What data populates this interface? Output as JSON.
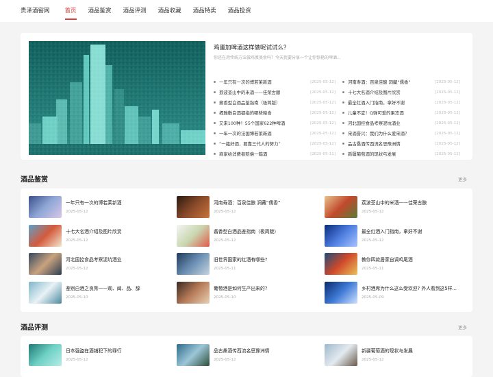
{
  "nav": {
    "items": [
      {
        "label": "贵泽酒窖网",
        "active": false
      },
      {
        "label": "首页",
        "active": true
      },
      {
        "label": "酒品鉴赏",
        "active": false
      },
      {
        "label": "酒品评测",
        "active": false
      },
      {
        "label": "酒品收藏",
        "active": false
      },
      {
        "label": "酒品特卖",
        "active": false
      },
      {
        "label": "酒品投资",
        "active": false
      }
    ]
  },
  "hero": {
    "title": "鸡蛋加啤酒这样做呢试试么？",
    "subtitle": "你还在用传统方法做鸡蛋美食吗？今天我要分享一个让你惊艳的啤酒...",
    "list_left": [
      {
        "title": "一年只有一次的博若莱新酒",
        "date": "[2025-05-12]"
      },
      {
        "title": "荔波荃山中的米酒——佳荣古酿",
        "date": "[2025-05-12]"
      },
      {
        "title": "酱香型白酒品鉴指南（极简版）",
        "date": "[2025-05-12]"
      },
      {
        "title": "揭雅敷白酒都指的哪些粮食",
        "date": "[2025-05-12]"
      },
      {
        "title": "又来100种！55个国家622种啤酒",
        "date": "[2025-05-12]"
      },
      {
        "title": "一年一次的法国博若莱新酒",
        "date": "[2025-05-12]"
      },
      {
        "title": "“一瓶好酒，要靠三代人的努力”",
        "date": "[2025-05-12]"
      },
      {
        "title": "商家给消费者赔偿一箱酒",
        "date": "[2025-05-11]"
      }
    ],
    "list_right": [
      {
        "title": "河南寿酒：百泉佳酿 洞藏“儒香”",
        "date": "[2025-05-12]"
      },
      {
        "title": "十七大名酒介绍及图片欣赏",
        "date": "[2025-05-12]"
      },
      {
        "title": "最全红酒入门指南，拿好不谢",
        "date": "[2025-05-12]"
      },
      {
        "title": "儿童不宜！Q弹可爱的果冻酒",
        "date": "[2025-05-12]"
      },
      {
        "title": "河北国控食品考察泥坑酒业",
        "date": "[2025-05-12]"
      },
      {
        "title": "宋酒誉兴：我们为什么爱宋酒？",
        "date": "[2025-05-12]"
      },
      {
        "title": "品古桑酒传西流名思豫洲情",
        "date": "[2025-05-12]"
      },
      {
        "title": "新疆葡萄酒的现状与发展",
        "date": "[2025-05-11]"
      }
    ]
  },
  "section1": {
    "title": "酒品鉴赏",
    "more": "更多",
    "items": [
      {
        "title": "一年只有一次的博若莱新酒",
        "date": "2025-05-12",
        "thumb": "grapes"
      },
      {
        "title": "河南寿酒：百泉佳酿 洞藏“儒香”",
        "date": "2025-05-12",
        "thumb": "cellar"
      },
      {
        "title": "荔波荃山中的米酒——佳荣古酿",
        "date": "2025-05-12",
        "thumb": "market"
      },
      {
        "title": "十七大名酒介绍及图片欣赏",
        "date": "2025-05-12",
        "thumb": "bottles"
      },
      {
        "title": "酱香型白酒品鉴指南（极简版）",
        "date": "2025-05-12",
        "thumb": "map"
      },
      {
        "title": "最全红酒入门指南，拿好不谢",
        "date": "2025-05-12",
        "thumb": "blue"
      },
      {
        "title": "河北国控食品考察泥坑酒业",
        "date": "2025-05-12",
        "thumb": "people"
      },
      {
        "title": "旧世界国家的红酒有哪些?",
        "date": "2025-05-11",
        "thumb": "ship"
      },
      {
        "title": "教你四款居家自调鸡尾酒",
        "date": "2025-05-11",
        "thumb": "containers"
      },
      {
        "title": "鉴别白酒之良莠——观、闻、品、辞",
        "date": "2025-05-10",
        "thumb": "tablet"
      },
      {
        "title": "葡萄酒是如何生产出来的?",
        "date": "2025-05-10",
        "thumb": "woman"
      },
      {
        "title": "乡村酒席为什么这么受欢迎? 外人看到这5样...",
        "date": "2025-05-09",
        "thumb": "sky"
      }
    ]
  },
  "section2": {
    "title": "酒品评测",
    "more": "更多",
    "items": [
      {
        "title": "日本强盗在酒铺犯下的罪行",
        "date": "2025-05-12",
        "thumb": "teal"
      },
      {
        "title": "品古桑酒传西流名思豫洲情",
        "date": "2025-05-12",
        "thumb": "tower"
      },
      {
        "title": "新疆葡萄酒的现状与发展",
        "date": "2025-05-12",
        "thumb": "city"
      }
    ]
  }
}
